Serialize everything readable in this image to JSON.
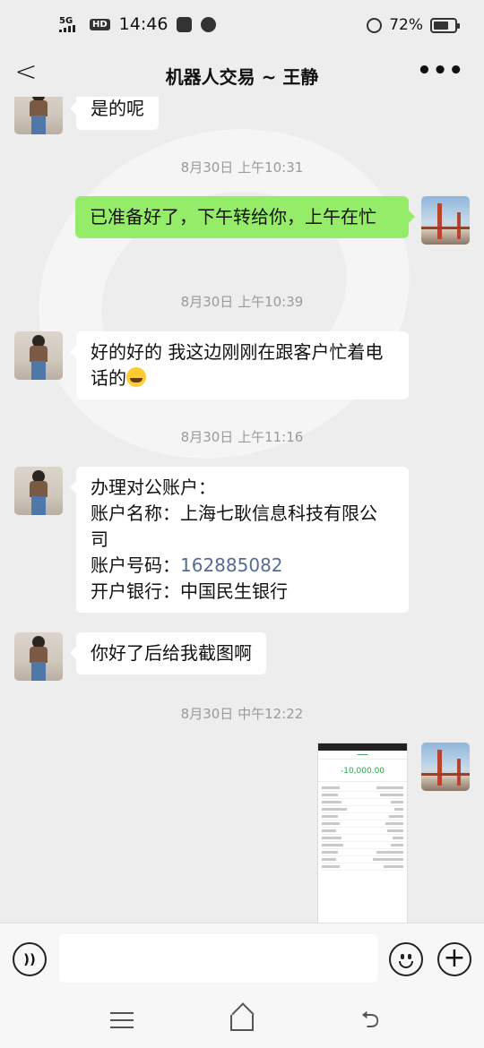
{
  "status_bar": {
    "network": "5G",
    "hd": "HD",
    "time": "14:46",
    "battery_percent": "72%",
    "battery_level": 0.72
  },
  "nav": {
    "title": "机器人交易 ~ 王静",
    "back": "<",
    "more": "•••"
  },
  "messages": [
    {
      "side": "in",
      "text": "是的呢"
    },
    {
      "type": "time",
      "text": "8月30日 上午10:31"
    },
    {
      "side": "out",
      "text": "已准备好了，下午转给你，上午在忙"
    },
    {
      "type": "time",
      "text": "8月30日 上午10:39"
    },
    {
      "side": "in",
      "text": "好的好的  我这边刚刚在跟客户忙着电话的"
    },
    {
      "type": "time",
      "text": "8月30日 上午11:16"
    },
    {
      "side": "in",
      "lines": [
        "办理对公账户：",
        "账户名称：上海七耿信息科技有限公司",
        "账户号码：",
        "162885082",
        "开户银行：中国民生银行"
      ]
    },
    {
      "side": "in",
      "text": "你好了后给我截图啊"
    },
    {
      "type": "time",
      "text": "8月30日 中午12:22"
    },
    {
      "side": "out",
      "type": "image",
      "screenshot_amount": "-10,000.00"
    }
  ],
  "input": {
    "placeholder": ""
  },
  "colors": {
    "out_bubble": "#95ec69",
    "in_bubble": "#ffffff",
    "link": "#576b95",
    "background": "#ededed"
  },
  "icons": [
    "voice-icon",
    "emoji-icon",
    "plus-icon",
    "menu-icon",
    "home-icon",
    "return-icon",
    "back-icon",
    "more-icon"
  ]
}
